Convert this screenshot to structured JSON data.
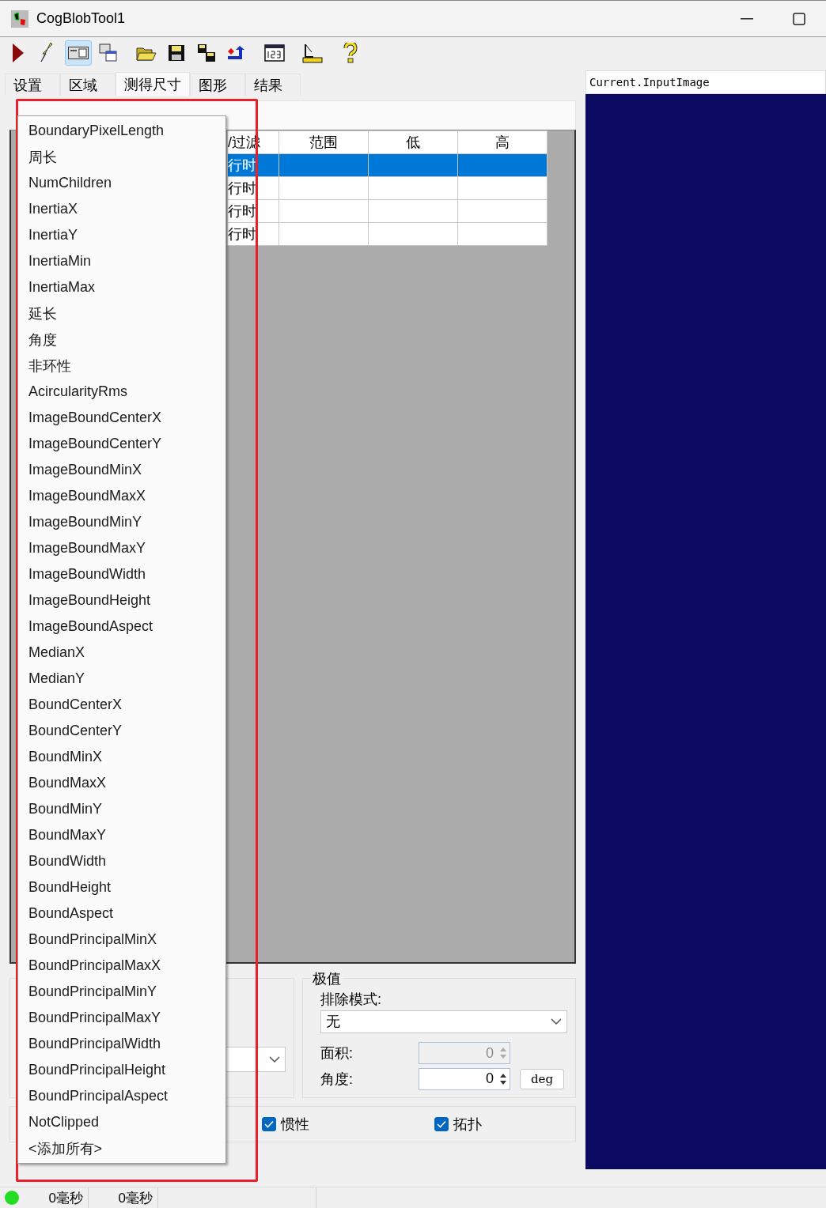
{
  "window": {
    "title": "CogBlobTool1"
  },
  "toolbar": [
    {
      "kind": "run",
      "selected": false
    },
    {
      "kind": "lightning",
      "selected": false
    },
    {
      "kind": "panel",
      "selected": true
    },
    {
      "kind": "windows",
      "selected": false
    },
    {
      "kind": "folder",
      "selected": false
    },
    {
      "kind": "floppy",
      "selected": false
    },
    {
      "kind": "floppy-copy",
      "selected": false
    },
    {
      "kind": "import",
      "selected": false
    },
    {
      "kind": "number",
      "selected": false
    },
    {
      "kind": "measure",
      "selected": false
    },
    {
      "kind": "help",
      "selected": false
    }
  ],
  "tabs": [
    {
      "label": "设置",
      "selected": false
    },
    {
      "label": "区域",
      "selected": false
    },
    {
      "label": "测得尺寸",
      "selected": true
    },
    {
      "label": "图形",
      "selected": false
    },
    {
      "label": "结果",
      "selected": false
    }
  ],
  "table": {
    "columns": [
      "/过滤",
      "范围",
      "低",
      "高"
    ],
    "rows": [
      {
        "column_1": "行时",
        "selected": true
      },
      {
        "column_1": "行时",
        "selected": false
      },
      {
        "column_1": "行时",
        "selected": false
      },
      {
        "column_1": "行时",
        "selected": false
      }
    ]
  },
  "property_menu": {
    "items": [
      "BoundaryPixelLength",
      "周长",
      "NumChildren",
      "InertiaX",
      "InertiaY",
      "InertiaMin",
      "InertiaMax",
      "延长",
      "角度",
      "非环性",
      "AcircularityRms",
      "ImageBoundCenterX",
      "ImageBoundCenterY",
      "ImageBoundMinX",
      "ImageBoundMaxX",
      "ImageBoundMinY",
      "ImageBoundMaxY",
      "ImageBoundWidth",
      "ImageBoundHeight",
      "ImageBoundAspect",
      "MedianX",
      "MedianY",
      "BoundCenterX",
      "BoundCenterY",
      "BoundMinX",
      "BoundMaxX",
      "BoundMinY",
      "BoundMaxY",
      "BoundWidth",
      "BoundHeight",
      "BoundAspect",
      "BoundPrincipalMinX",
      "BoundPrincipalMaxX",
      "BoundPrincipalMinY",
      "BoundPrincipalMaxY",
      "BoundPrincipalWidth",
      "BoundPrincipalHeight",
      "BoundPrincipalAspect",
      "NotClipped",
      "<添加所有>"
    ]
  },
  "extremes": {
    "title": "极值",
    "mode_label": "排除模式:",
    "mode_value": "无",
    "fields": [
      {
        "label": "面积:",
        "value": "0",
        "disabled": true
      },
      {
        "label": "角度:",
        "value": "0",
        "disabled": false
      }
    ],
    "unit_button": "deg"
  },
  "options": [
    {
      "label": "惯性",
      "checked": true
    },
    {
      "label": "拓扑",
      "checked": true
    }
  ],
  "image_display": {
    "title": "Current.InputImage"
  },
  "status_bar": {
    "times": [
      "0毫秒",
      "0毫秒"
    ]
  }
}
